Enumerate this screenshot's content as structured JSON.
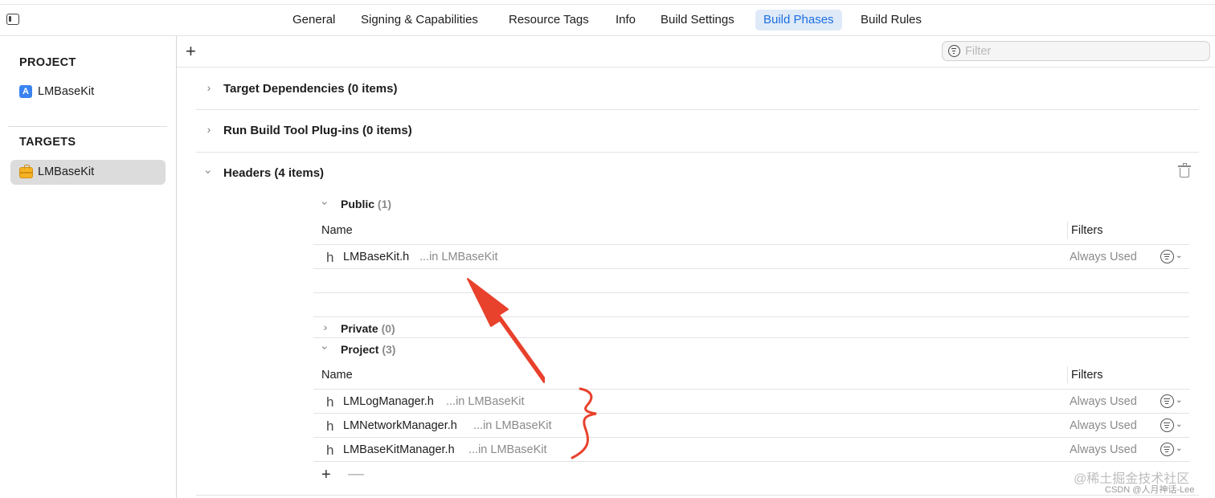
{
  "tabs": {
    "general": "General",
    "signing": "Signing & Capabilities",
    "resource_tags": "Resource Tags",
    "info": "Info",
    "build_settings": "Build Settings",
    "build_phases": "Build Phases",
    "build_rules": "Build Rules",
    "active": "Build Phases"
  },
  "sidebar": {
    "project_heading": "PROJECT",
    "project_item": "LMBaseKit",
    "targets_heading": "TARGETS",
    "target_item": "LMBaseKit"
  },
  "toolbar": {
    "add_label": "+",
    "filter_placeholder": "Filter"
  },
  "phases": {
    "target_dependencies": "Target Dependencies (0 items)",
    "run_build_tool": "Run Build Tool Plug-ins (0 items)",
    "headers": "Headers (4 items)"
  },
  "headers": {
    "public": {
      "label": "Public",
      "count": "(1)"
    },
    "private": {
      "label": "Private",
      "count": "(0)"
    },
    "project": {
      "label": "Project",
      "count": "(3)"
    },
    "col_name": "Name",
    "col_filters": "Filters",
    "public_rows": [
      {
        "icon": "h",
        "name": "LMBaseKit.h",
        "location": "...in LMBaseKit",
        "filter": "Always Used"
      }
    ],
    "project_rows": [
      {
        "icon": "h",
        "name": "LMLogManager.h",
        "location": "...in LMBaseKit",
        "filter": "Always Used"
      },
      {
        "icon": "h",
        "name": "LMNetworkManager.h",
        "location": "...in LMBaseKit",
        "filter": "Always Used"
      },
      {
        "icon": "h",
        "name": "LMBaseKitManager.h",
        "location": "...in LMBaseKit",
        "filter": "Always Used"
      }
    ],
    "add_label": "+",
    "remove_label": "—"
  },
  "watermark": {
    "line1": "@稀土掘金技术社区",
    "line2": "CSDN @人月神话-Lee"
  },
  "icons": {
    "sidebar_toggle": "sidebar-toggle-icon",
    "project": "app-project-icon",
    "target": "toolbox-target-icon",
    "filter": "filter-icon",
    "trash": "trash-icon",
    "row_menu": "filter-menu-icon"
  },
  "colors": {
    "accent": "#1b6fe0",
    "active_tab_bg": "#dfeaf9",
    "annotation": "#e8412c"
  }
}
